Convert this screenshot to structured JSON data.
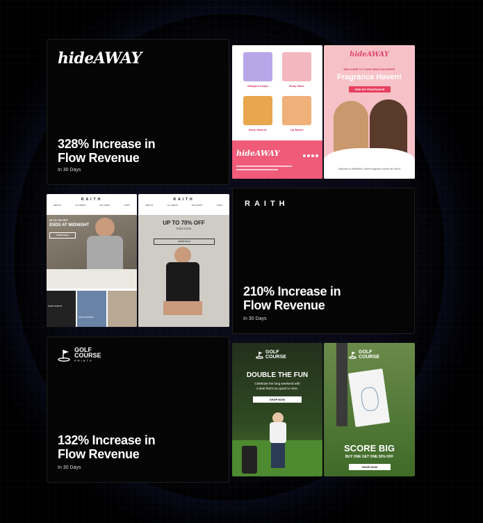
{
  "cards": [
    {
      "logo": "hideAWAY",
      "stat_line1": "328% Increase in",
      "stat_line2": "Flow Revenue",
      "sub": "In 30 Days"
    },
    {
      "logo": "RAITH",
      "stat_line1": "210% Increase in",
      "stat_line2": "Flow Revenue",
      "sub": "In 30 Days"
    },
    {
      "logo_line1": "GOLF",
      "logo_line2": "COURSE",
      "logo_line3": "PRINTS",
      "stat_line1": "132% Increase in",
      "stat_line2": "Flow Revenue",
      "sub": "In 30 Days"
    }
  ],
  "hide_preview": {
    "products": [
      "Whipped Soaps",
      "Body Mists",
      "Body Washes",
      "Lip Balms"
    ],
    "footer_logo": "hideAWAY",
    "logo": "hideAWAY",
    "welcome": "WELCOME TO YOUR NEW FAVOURITE",
    "headline": "Fragrance Haven!",
    "cta": "FIND MY FRAGRANCE",
    "body": "Welcome to hideAWAY, where fragrance meets fun! We're"
  },
  "raith_preview": {
    "brand": "RAITH",
    "nav": [
      "NEW IN",
      "ALL MENS",
      "90's SHOP",
      "TOPS"
    ],
    "left_small": "UP TO 70% OFF",
    "left_big": "ENDS AT MIDNIGHT",
    "left_btn": "SHOP SALE",
    "left_label1": "SHOP SHIRTS",
    "left_label2": "SHOP SHORTS",
    "right_big": "UP TO 70% OFF",
    "right_small": "ENDS SOON",
    "right_btn": "SHOP SALE"
  },
  "golf_preview": {
    "logo_line1": "GOLF",
    "logo_line2": "COURSE",
    "left_head": "DOUBLE THE FUN",
    "left_body1": "Celebrate the long weekend with",
    "left_body2": "a deal that's too good to miss.",
    "left_btn": "SHOP NOW",
    "right_head": "SCORE BIG",
    "right_body": "BUY ONE GET ONE 50% OFF",
    "right_btn": "SHOP NOW"
  }
}
